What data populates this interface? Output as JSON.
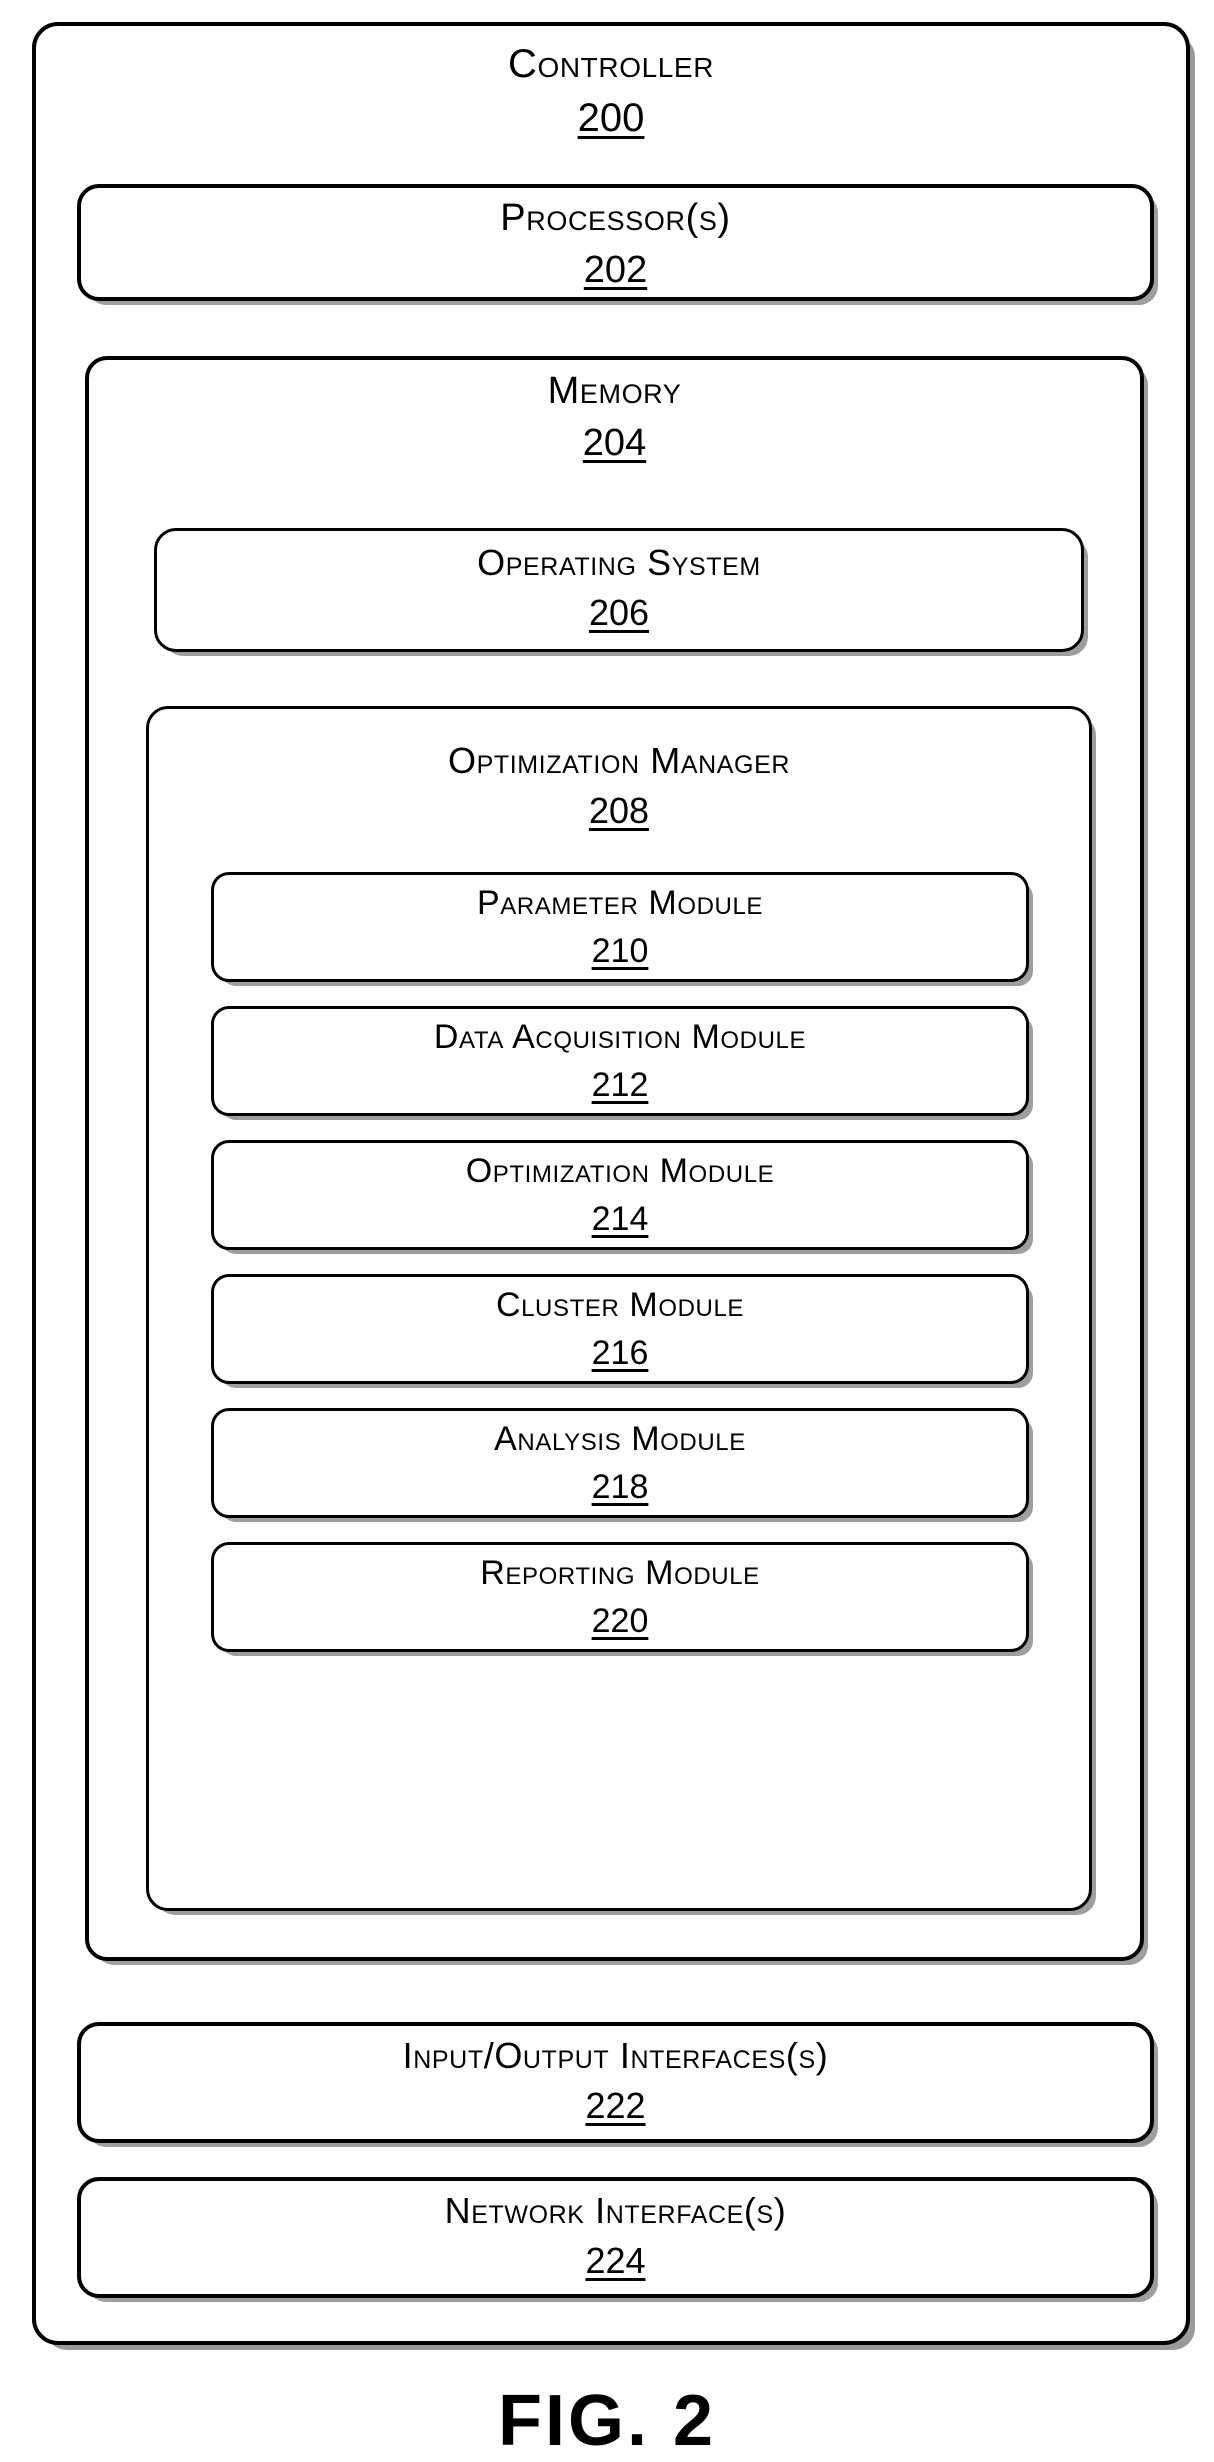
{
  "figure": {
    "caption": "FIG. 2"
  },
  "controller": {
    "title": "Controller",
    "numeral": "200",
    "processor": {
      "title": "Processor(s)",
      "numeral": "202"
    },
    "memory": {
      "title": "Memory",
      "numeral": "204",
      "operating_system": {
        "title": "Operating System",
        "numeral": "206"
      },
      "optimization_manager": {
        "title": "Optimization Manager",
        "numeral": "208",
        "modules": [
          {
            "title": "Parameter Module",
            "numeral": "210"
          },
          {
            "title": "Data Acquisition Module",
            "numeral": "212"
          },
          {
            "title": "Optimization Module",
            "numeral": "214"
          },
          {
            "title": "Cluster Module",
            "numeral": "216"
          },
          {
            "title": "Analysis Module",
            "numeral": "218"
          },
          {
            "title": "Reporting Module",
            "numeral": "220"
          }
        ]
      }
    },
    "io_interfaces": {
      "title": "Input/Output Interfaces(s)",
      "numeral": "222"
    },
    "network_interfaces": {
      "title": "Network Interface(s)",
      "numeral": "224"
    }
  }
}
